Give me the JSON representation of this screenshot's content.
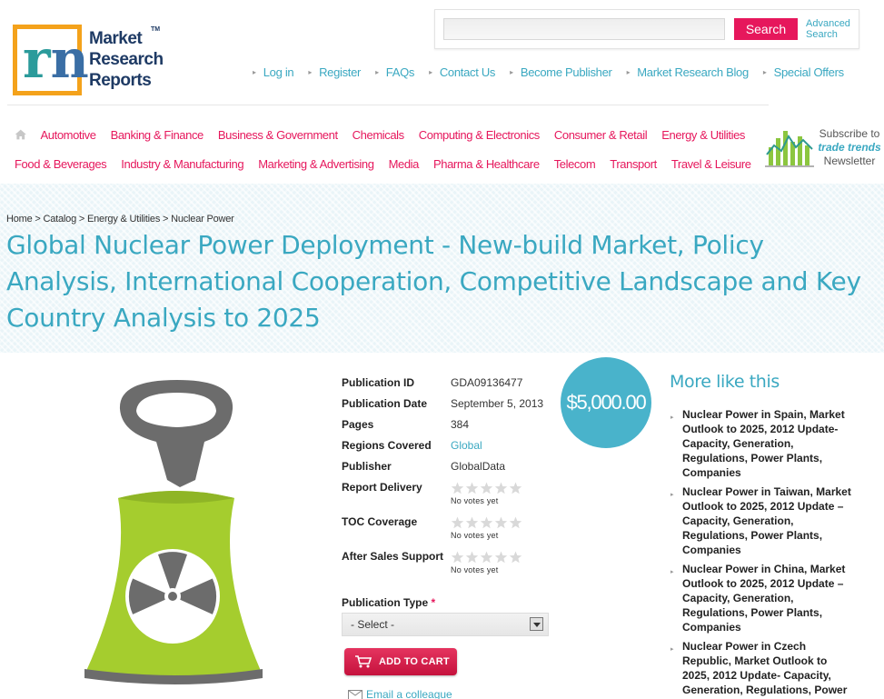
{
  "brand": {
    "logo_line1": "Market",
    "logo_line2": "Research",
    "logo_line3": "Reports",
    "tm": "TM"
  },
  "search": {
    "placeholder": "",
    "button_label": "Search",
    "advanced_line1": "Advanced",
    "advanced_line2": "Search"
  },
  "topnav": [
    "Log in",
    "Register",
    "FAQs",
    "Contact Us",
    "Become Publisher",
    "Market Research Blog",
    "Special Offers"
  ],
  "categories_row1": [
    "Automotive",
    "Banking & Finance",
    "Business & Government",
    "Chemicals",
    "Computing & Electronics",
    "Consumer & Retail",
    "Energy & Utilities"
  ],
  "categories_row2": [
    "Food & Beverages",
    "Industry & Manufacturing",
    "Marketing & Advertising",
    "Media",
    "Pharma & Healthcare",
    "Telecom",
    "Transport",
    "Travel & Leisure"
  ],
  "newsletter": {
    "line1": "Subscribe to",
    "line2": "trade trends",
    "line3": "Newsletter"
  },
  "breadcrumb": {
    "home": "Home",
    "catalog": "Catalog",
    "category": "Energy & Utilities",
    "current": "Nuclear Power",
    "sep": ">"
  },
  "title": "Global Nuclear Power Deployment - New-build Market, Policy Analysis, International Cooperation, Competitive Landscape and Key Country Analysis to 2025",
  "details": {
    "publication_id_label": "Publication ID",
    "publication_id": "GDA09136477",
    "publication_date_label": "Publication Date",
    "publication_date": "September 5, 2013",
    "pages_label": "Pages",
    "pages": "384",
    "regions_label": "Regions Covered",
    "regions": "Global",
    "publisher_label": "Publisher",
    "publisher": "GlobalData"
  },
  "ratings": [
    {
      "label": "Report Delivery",
      "votes_text": "No votes yet",
      "stars": 0
    },
    {
      "label": "TOC Coverage",
      "votes_text": "No votes yet",
      "stars": 0
    },
    {
      "label": "After Sales Support",
      "votes_text": "No votes yet",
      "stars": 0
    }
  ],
  "price": "$5,000.00",
  "publication_type": {
    "label": "Publication Type",
    "required_mark": "*",
    "selected": "- Select -"
  },
  "cart_button": "ADD TO CART",
  "email_link": "Email a colleague",
  "more_like_this": {
    "title": "More like this",
    "items": [
      "Nuclear Power in Spain, Market Outlook to 2025, 2012 Update- Capacity, Generation, Regulations, Power Plants, Companies",
      "Nuclear Power in Taiwan, Market Outlook to 2025, 2012 Update – Capacity, Generation, Regulations, Power Plants, Companies",
      "Nuclear Power in China, Market Outlook to 2025, 2012 Update – Capacity, Generation, Regulations, Power Plants, Companies",
      "Nuclear Power in Czech Republic, Market Outlook to 2025, 2012 Update- Capacity, Generation, Regulations, Power"
    ]
  },
  "colors": {
    "accent_teal": "#3aa8c1",
    "accent_pink": "#e6175c",
    "logo_orange": "#f4a21b",
    "tower_green": "#a5cd2e"
  }
}
